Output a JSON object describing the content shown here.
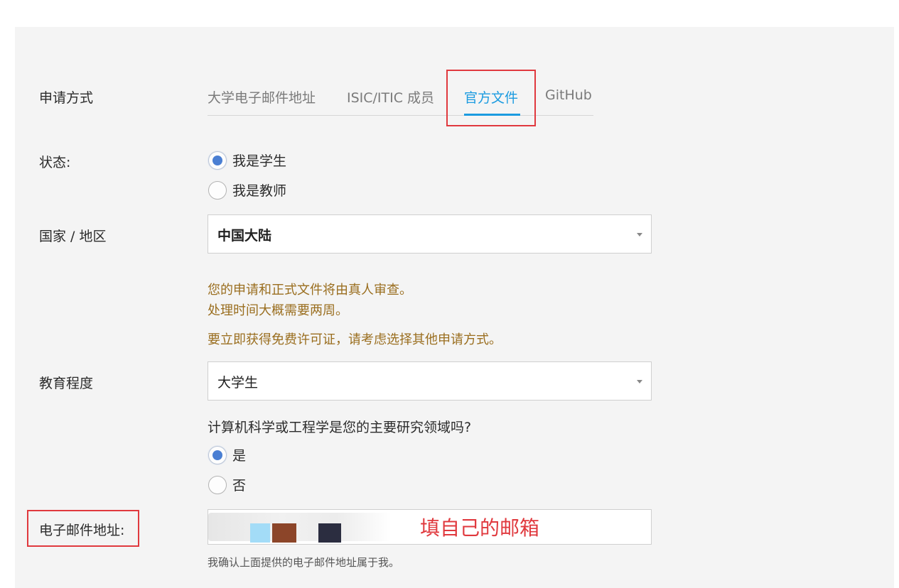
{
  "form": {
    "method_label": "申请方式",
    "tabs": [
      {
        "label": "大学电子邮件地址",
        "active": false
      },
      {
        "label": "ISIC/ITIC 成员",
        "active": false
      },
      {
        "label": "官方文件",
        "active": true
      },
      {
        "label": "GitHub",
        "active": false
      }
    ],
    "status": {
      "label": "状态:",
      "options": [
        {
          "label": "我是学生",
          "checked": true
        },
        {
          "label": "我是教师",
          "checked": false
        }
      ]
    },
    "country": {
      "label": "国家 / 地区",
      "value": "中国大陆"
    },
    "notice": {
      "line1": "您的申请和正式文件将由真人审查。",
      "line2": "处理时间大概需要两周。",
      "line3": "要立即获得免费许可证，请考虑选择其他申请方式。"
    },
    "education": {
      "label": "教育程度",
      "value": "大学生"
    },
    "cs_question": {
      "text": "计算机科学或工程学是您的主要研究领域吗?",
      "options": [
        {
          "label": "是",
          "checked": true
        },
        {
          "label": "否",
          "checked": false
        }
      ]
    },
    "email": {
      "label": "电子邮件地址:",
      "annotation": "填自己的邮箱",
      "confirm_text": "我确认上面提供的电子邮件地址属于我。"
    }
  },
  "colors": {
    "accent": "#1b9be0",
    "notice": "#9a6e1f",
    "annotation_red": "#e0393e",
    "radio_checked": "#4a7fd3"
  }
}
